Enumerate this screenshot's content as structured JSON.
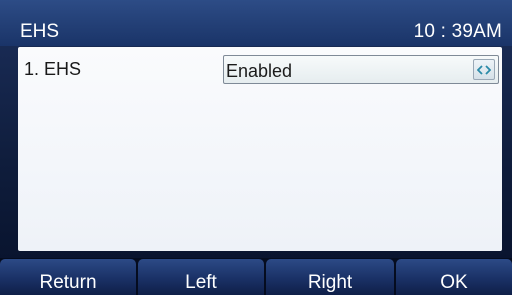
{
  "title_bar": {
    "title": "EHS",
    "time": "10 : 39AM"
  },
  "settings": {
    "items": [
      {
        "label": "1. EHS",
        "value": "Enabled",
        "switch_icon": "left-right-arrows-icon"
      }
    ]
  },
  "softkeys": {
    "return": "Return",
    "left": "Left",
    "right": "Right",
    "ok": "OK"
  },
  "colors": {
    "title_bar": "#2d4c86",
    "softkey": "#1a3166",
    "panel": "#f4f6fa",
    "arrow_icon": "#2a8aa8"
  }
}
